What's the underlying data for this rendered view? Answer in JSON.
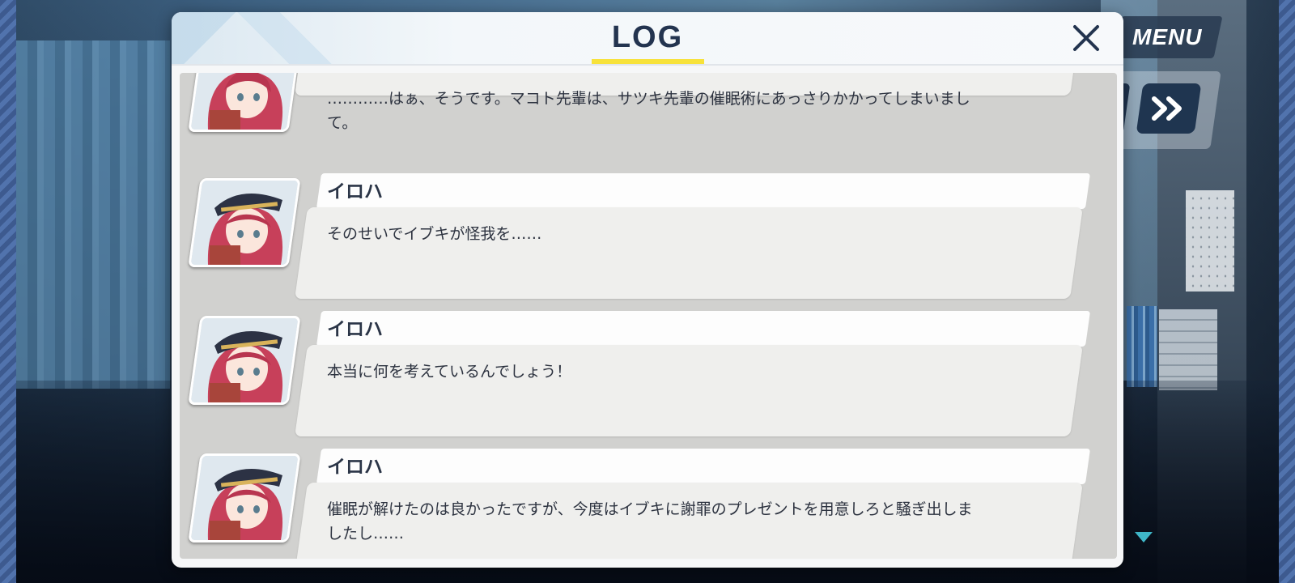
{
  "log": {
    "title": "LOG",
    "entries": [
      {
        "name": "",
        "text": "…………はぁ、そうです。マコト先輩は、サツキ先輩の催眠術にあっさりかかってしまいまし\nて。"
      },
      {
        "name": "イロハ",
        "text": "そのせいでイブキが怪我を……"
      },
      {
        "name": "イロハ",
        "text": "本当に何を考えているんでしょう！"
      },
      {
        "name": "イロハ",
        "text": "催眠が解けたのは良かったですが、今度はイブキに謝罪のプレゼントを用意しろと騒ぎ出しま\nしたし……"
      }
    ]
  },
  "hud": {
    "menu_label": "MENU"
  },
  "icons": {
    "close": "close-icon",
    "skip": "fast-forward-icon",
    "next": "triangle-down-icon"
  },
  "colors": {
    "title_underline": "#f7e23a",
    "title_text": "#23344f",
    "hud_button": "#1f3550",
    "next_arrow": "#3fb6c8"
  }
}
